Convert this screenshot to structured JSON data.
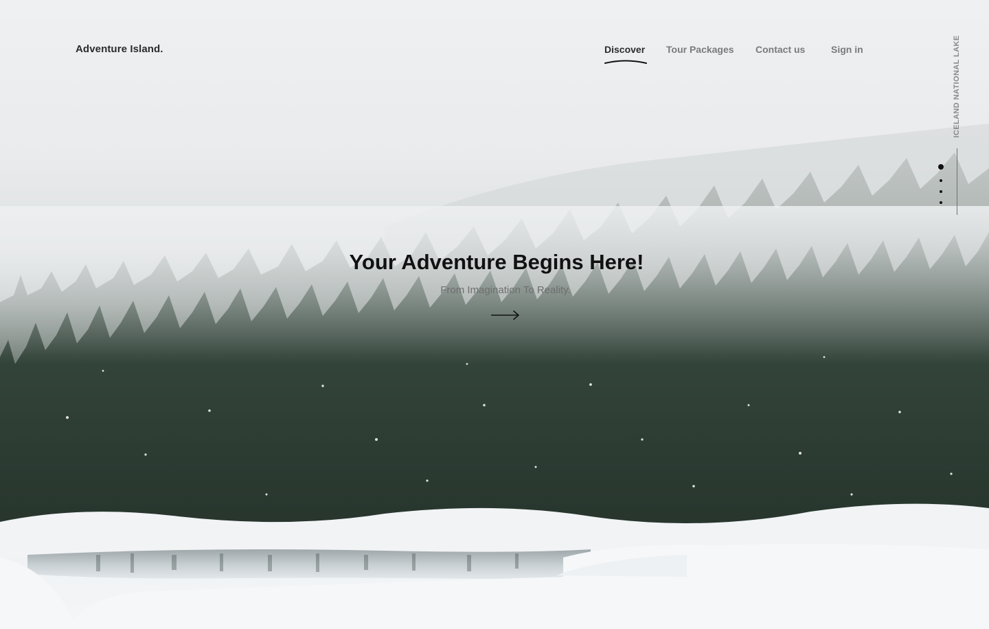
{
  "brand": {
    "name": "Adventure Island."
  },
  "nav": {
    "items": [
      {
        "label": "Discover",
        "active": true
      },
      {
        "label": "Tour Packages",
        "active": false
      },
      {
        "label": "Contact us",
        "active": false
      },
      {
        "label": "Sign in",
        "active": false
      }
    ]
  },
  "hero": {
    "title": "Your Adventure Begins Here!",
    "subtitle": "From Imagination To Reality.",
    "cta_icon": "arrow-right-icon",
    "location_label": "ICELAND NATIONAL LAKE"
  },
  "slider": {
    "count": 4,
    "active_index": 0
  },
  "colors": {
    "text_dark": "#111111",
    "nav_inactive": "#7a7a7a",
    "snow": "#f4f6f8",
    "forest": "#2e3c33"
  }
}
